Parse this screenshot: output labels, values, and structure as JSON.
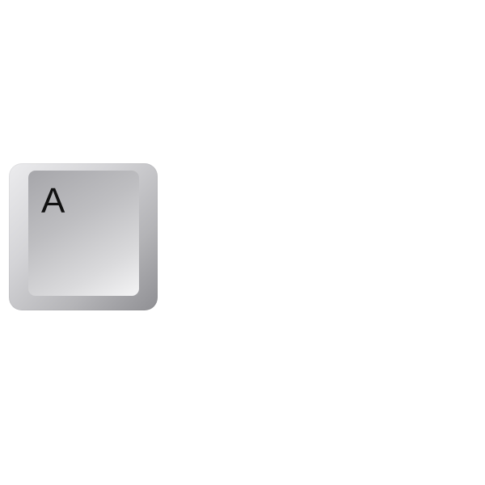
{
  "key": {
    "label": "A",
    "colors": {
      "outer_light": "#ececee",
      "outer_dark": "#8f8f93",
      "face_light": "#f4f4f5",
      "face_dark": "#a6a6aa",
      "text": "#111111"
    }
  }
}
